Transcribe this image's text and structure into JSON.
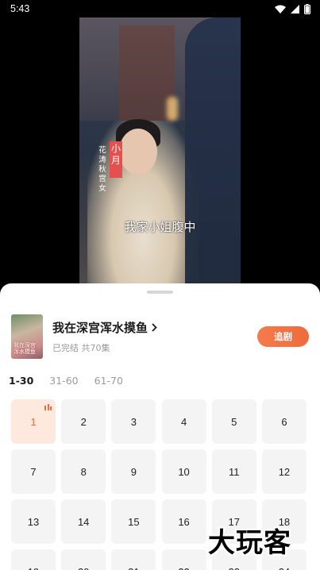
{
  "status": {
    "time": "5:43",
    "icons": [
      "wifi-icon",
      "signal-icon",
      "battery-icon"
    ]
  },
  "video": {
    "name_tag": "小月",
    "name_sub": "花涛秋宫女",
    "subtitle": "我家小姐腹中"
  },
  "series": {
    "cover_text": "我在深宫浑水摸鱼",
    "title": "我在深宫浑水摸鱼",
    "meta": "已完结 共70集",
    "follow_label": "追剧"
  },
  "ranges": [
    "1-30",
    "31-60",
    "61-70"
  ],
  "active_range": 0,
  "episodes": [
    "1",
    "2",
    "3",
    "4",
    "5",
    "6",
    "7",
    "8",
    "9",
    "10",
    "11",
    "12",
    "13",
    "14",
    "15",
    "16",
    "17",
    "18",
    "19",
    "20",
    "21",
    "22",
    "23",
    "24"
  ],
  "current_episode": 0,
  "watermark": "大玩客",
  "colors": {
    "accent": "#f26a3a",
    "active_bg": "#fde9de",
    "tile_bg": "#f4f4f4"
  }
}
